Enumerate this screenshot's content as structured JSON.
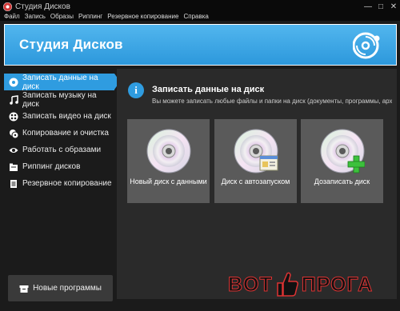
{
  "window": {
    "title": "Студия Дисков",
    "controls": [
      "minimize",
      "maximize",
      "close"
    ]
  },
  "menu": {
    "items": [
      "Файл",
      "Запись",
      "Образы",
      "Риппинг",
      "Резервное копирование",
      "Справка"
    ]
  },
  "header": {
    "title": "Студия Дисков",
    "logo_icon": "disc-logo-icon"
  },
  "sidebar": {
    "items": [
      {
        "label": "Записать данные на диск",
        "icon": "data-disc-icon",
        "active": true
      },
      {
        "label": "Записать музыку на диск",
        "icon": "music-note-icon",
        "active": false
      },
      {
        "label": "Записать видео на диск",
        "icon": "video-reel-icon",
        "active": false
      },
      {
        "label": "Копирование и очистка",
        "icon": "copy-disc-icon",
        "active": false
      },
      {
        "label": "Работать с образами",
        "icon": "eye-icon",
        "active": false
      },
      {
        "label": "Риппинг дисков",
        "icon": "folder-icon",
        "active": false
      },
      {
        "label": "Резервное копирование",
        "icon": "document-icon",
        "active": false
      }
    ],
    "new_programs_label": "Новые программы",
    "new_programs_icon": "box-icon"
  },
  "content": {
    "title": "Записать данные на диск",
    "description": "Вы можете записать любые файлы и папки на диск (документы, программы, архивы",
    "tiles": [
      {
        "label": "Новый диск с данными",
        "icon": "disc-icon"
      },
      {
        "label": "Диск с автозапуском",
        "icon": "disc-autorun-icon"
      },
      {
        "label": "Дозаписать диск",
        "icon": "disc-add-icon"
      }
    ]
  },
  "watermark": {
    "part1": "BOT",
    "part2": "ПРОГА"
  },
  "colors": {
    "accent": "#2f9ce0",
    "header_top": "#52b6ee",
    "header_bottom": "#2c98dc",
    "background": "#1b1b1b",
    "tile": "#5a5a5a",
    "add_green": "#3cc13c"
  }
}
